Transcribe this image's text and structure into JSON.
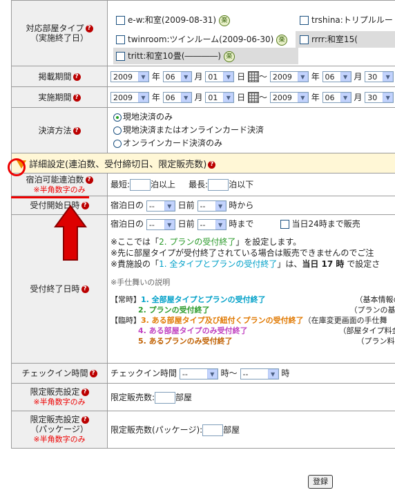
{
  "help_mark": "?",
  "rows": {
    "room_type": {
      "label": "対応部屋タイプ",
      "sublabel": "（実施終了日）",
      "items": [
        {
          "text": "e-w:和室(2009-08-31)",
          "raku": "楽"
        },
        {
          "text": "trshina:トリプルルー"
        },
        {
          "text": "twinroom:ツインルーム(2009-06-30)",
          "raku": "楽"
        },
        {
          "text": "rrrr:和室15("
        },
        {
          "text": "tritt:和室10畳(――――)",
          "raku": "楽"
        }
      ]
    },
    "post_period": {
      "label": "掲載期間",
      "y1": "2009",
      "m1": "06",
      "d1": "01",
      "y2": "2009",
      "m2": "06",
      "d2": "30"
    },
    "exec_period": {
      "label": "実施期間",
      "y1": "2009",
      "m1": "06",
      "d1": "01",
      "y2": "2009",
      "m2": "06",
      "d2": "30"
    },
    "units": {
      "year": "年",
      "month": "月",
      "day": "日",
      "tilde": "～"
    },
    "payment": {
      "label": "決済方法",
      "options": [
        "現地決済のみ",
        "現地決済またはオンラインカード決済",
        "オンラインカード決済のみ"
      ],
      "selected_index": 0
    },
    "detail_section": {
      "title": "詳細設定(連泊数、受付締切日、限定販売数)"
    },
    "nights": {
      "label": "宿泊可能連泊数",
      "note": "※半角数字のみ",
      "min_label": "最短:",
      "min_suffix": "泊以上",
      "max_label": "最長:",
      "max_suffix": "泊以下"
    },
    "accept_start": {
      "label": "受付開始日時",
      "prefix": "宿泊日の",
      "sel1": "--",
      "mid": "日前",
      "sel2": "--",
      "suffix": "時から"
    },
    "accept_end": {
      "label": "受付終了日時",
      "prefix": "宿泊日の",
      "sel1": "--",
      "mid": "日前",
      "sel2": "--",
      "suffix": "時まで",
      "checkbox_label": "当日24時まで販売",
      "notes": [
        "※ここでは「2. プランの受付終了」を設定します。",
        "※先に部屋タイプが受付終了されている場合は販売できませんのでご注",
        "※貴施設の「1. 全タイプとプランの受付終了」は、"
      ],
      "note1_highlight": "2. プランの受付終了",
      "note3_highlight": "1. 全タイプとプランの受付終了",
      "note3_bold": "当日 17 時",
      "note3_tail": "で設定さ",
      "explain_title": "※手仕舞いの説明",
      "explain": [
        {
          "tag": "【常時】",
          "num": "1. 全部屋タイプとプランの受付終了",
          "right": "（基本情報の設"
        },
        {
          "tag": "",
          "num": "2. プランの受付終了",
          "right": "（プランの基本情"
        },
        {
          "tag": "【臨時】",
          "num": "3. ある部屋タイプ及び紐付くプランの受付終了",
          "right": "（在庫変更画面の手仕舞"
        },
        {
          "tag": "",
          "num": "4. ある部屋タイプのみ受付終了",
          "right": "（部屋タイプ料金を"
        },
        {
          "tag": "",
          "num": "5. あるプランのみ受付終了",
          "right": "（プラン料金を"
        }
      ]
    },
    "checkin": {
      "label": "チェックイン時間",
      "prefix": "チェックイン時間",
      "sel1": "--",
      "mid": "時～",
      "sel2": "--",
      "suffix": "時"
    },
    "limited": {
      "label": "限定販売設定",
      "note": "※半角数字のみ",
      "prefix": "限定販売数:",
      "suffix": "部屋"
    },
    "limited_pkg": {
      "label": "限定販売設定",
      "sublabel": "（パッケージ）",
      "note": "※半角数字のみ",
      "prefix": "限定販売数(パッケージ):",
      "suffix": "部屋"
    }
  },
  "submit_label": "登録"
}
